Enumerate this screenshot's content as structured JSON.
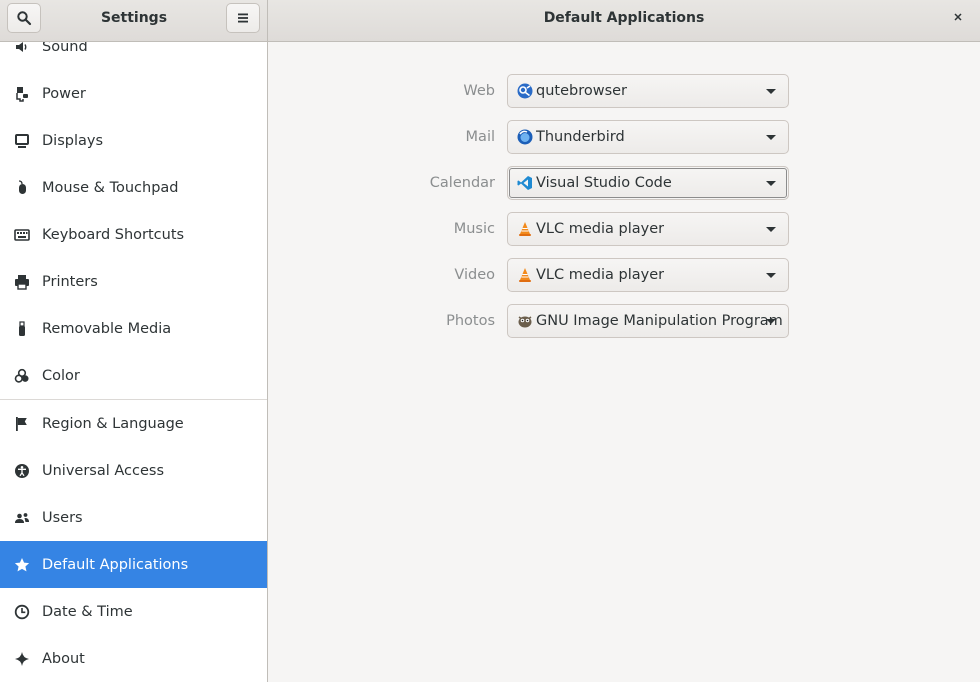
{
  "header": {
    "left_title": "Settings",
    "right_title": "Default Applications",
    "search_icon": "search-icon",
    "menu_icon": "hamburger-menu-icon",
    "close_icon": "close-icon"
  },
  "sidebar": {
    "items": [
      {
        "label": "Sound",
        "icon": "speaker-icon"
      },
      {
        "label": "Power",
        "icon": "power-plug-icon"
      },
      {
        "label": "Displays",
        "icon": "monitor-icon"
      },
      {
        "label": "Mouse & Touchpad",
        "icon": "mouse-icon"
      },
      {
        "label": "Keyboard Shortcuts",
        "icon": "keyboard-icon"
      },
      {
        "label": "Printers",
        "icon": "printer-icon"
      },
      {
        "label": "Removable Media",
        "icon": "usb-stick-icon"
      },
      {
        "label": "Color",
        "icon": "color-circles-icon"
      },
      {
        "label": "Region & Language",
        "icon": "flag-icon"
      },
      {
        "label": "Universal Access",
        "icon": "accessibility-icon"
      },
      {
        "label": "Users",
        "icon": "users-icon"
      },
      {
        "label": "Default Applications",
        "icon": "star-icon",
        "active": true
      },
      {
        "label": "Date & Time",
        "icon": "clock-icon"
      },
      {
        "label": "About",
        "icon": "sparkle-icon"
      }
    ],
    "active_color": "#3584e4"
  },
  "defaults": {
    "rows": [
      {
        "label": "Web",
        "app": "qutebrowser",
        "icon": "qutebrowser-icon"
      },
      {
        "label": "Mail",
        "app": "Thunderbird",
        "icon": "thunderbird-icon"
      },
      {
        "label": "Calendar",
        "app": "Visual Studio Code",
        "icon": "vscode-icon"
      },
      {
        "label": "Music",
        "app": "VLC media player",
        "icon": "vlc-icon"
      },
      {
        "label": "Video",
        "app": "VLC media player",
        "icon": "vlc-icon"
      },
      {
        "label": "Photos",
        "app": "GNU Image Manipulation Program",
        "icon": "gimp-icon"
      }
    ]
  }
}
